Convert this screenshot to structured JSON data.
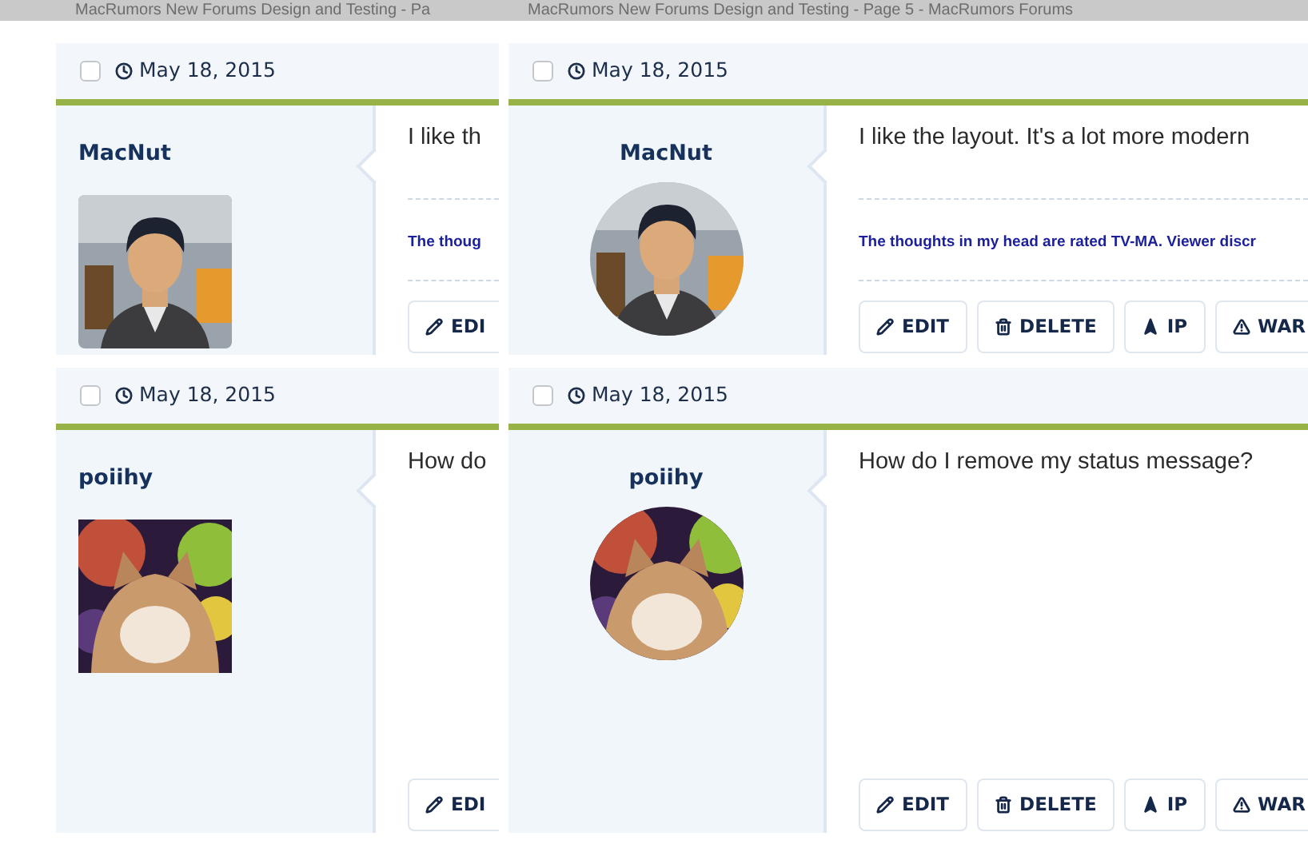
{
  "tab_titles": [
    "MacRumors New Forums Design and Testing - Pa",
    "MacRumors New Forums Design and Testing - Page 5 - MacRumors Forums"
  ],
  "windows": [
    {
      "round_avatars": false,
      "names_centered": false,
      "posts": [
        {
          "checked": false,
          "date": "May 18, 2015",
          "author": "MacNut",
          "avatar": {
            "kind": "figure"
          },
          "message": "I like th",
          "signature": "The thoug",
          "buttons": [
            {
              "kind": "edit",
              "label": "EDI"
            }
          ]
        },
        {
          "checked": false,
          "date": "May 18, 2015",
          "author": "poiihy",
          "avatar": {
            "kind": "picture"
          },
          "message": "How do",
          "buttons": [
            {
              "kind": "edit",
              "label": "EDI"
            }
          ]
        }
      ]
    },
    {
      "round_avatars": true,
      "names_centered": true,
      "posts": [
        {
          "checked": false,
          "date": "May 18, 2015",
          "author": "MacNut",
          "avatar": {
            "kind": "figure"
          },
          "message": "I like the layout. It's a lot more modern",
          "signature": "The thoughts in my head are rated TV-MA. Viewer discr",
          "buttons": [
            {
              "kind": "edit",
              "label": "EDIT"
            },
            {
              "kind": "delete",
              "label": "DELETE"
            },
            {
              "kind": "ip",
              "label": "IP"
            },
            {
              "kind": "warn",
              "label": "WAR"
            }
          ]
        },
        {
          "checked": false,
          "date": "May 18, 2015",
          "author": "poiihy",
          "avatar": {
            "kind": "picture"
          },
          "message": "How do I remove my status message?",
          "buttons": [
            {
              "kind": "edit",
              "label": "EDIT"
            },
            {
              "kind": "delete",
              "label": "DELETE"
            },
            {
              "kind": "ip",
              "label": "IP"
            },
            {
              "kind": "warn",
              "label": "WAR"
            }
          ]
        }
      ]
    }
  ]
}
